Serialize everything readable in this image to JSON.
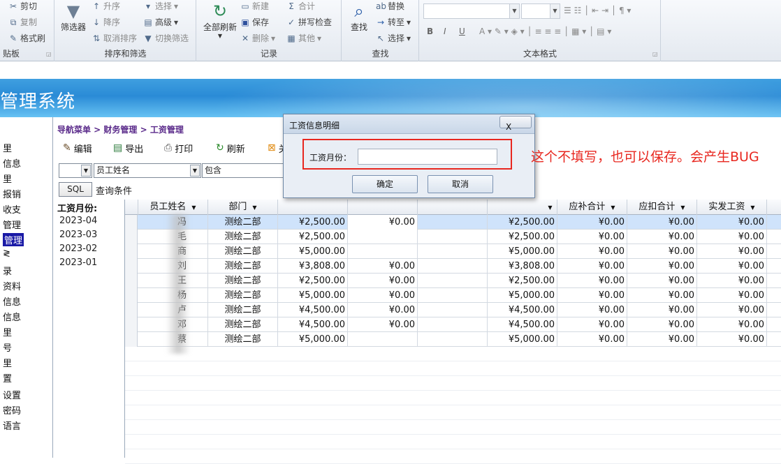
{
  "ribbon": {
    "clipboard": {
      "cut": "剪切",
      "copy": "复制",
      "format_painter": "格式刷",
      "group_label": "贴板"
    },
    "sort_filter": {
      "filter_label": "筛选器",
      "ascending": "升序",
      "descending": "降序",
      "remove_sort": "取消排序",
      "selection": "选择",
      "advanced": "高级",
      "toggle_filter": "切换筛选",
      "group_label": "排序和筛选"
    },
    "records": {
      "refresh_all": "全部刷新",
      "new": "新建",
      "save": "保存",
      "delete": "删除",
      "totals": "合计",
      "spelling": "拼写检查",
      "more": "其他",
      "group_label": "记录"
    },
    "find": {
      "find": "查找",
      "replace": "替换",
      "goto": "转至",
      "select": "选择",
      "group_label": "查找"
    },
    "text_format": {
      "bold": "B",
      "italic": "I",
      "underline": "U",
      "font_color": "A",
      "group_label": "文本格式"
    }
  },
  "app": {
    "title": "管理系统"
  },
  "nav": {
    "items": [
      "里",
      "信息",
      "里",
      "报销",
      "收支",
      "管理",
      "管理",
      "≷",
      "录",
      "资料",
      "信息",
      "信息",
      "里",
      "号",
      "里",
      "置",
      "设置",
      "密码",
      "语言"
    ],
    "selected_index": 6
  },
  "breadcrumb": "导航菜单 > 财务管理 > 工资管理",
  "toolbar": {
    "edit": "编辑",
    "export": "导出",
    "print": "打印",
    "refresh": "刷新",
    "close_partial": "关"
  },
  "filter": {
    "field_name": "员工姓名",
    "operator": "包含",
    "sql_button": "SQL",
    "query_label": "查询条件"
  },
  "months": {
    "header": "工资月份:",
    "items": [
      "2023-04",
      "2023-03",
      "2023-02",
      "2023-01"
    ]
  },
  "grid": {
    "columns": [
      "员工姓名",
      "部门",
      "",
      "",
      "",
      "",
      "应补合计",
      "应扣合计",
      "实发工资"
    ],
    "rows": [
      {
        "name": "冯",
        "dept": "测绘二部",
        "base": "¥2,500.00",
        "c2": "¥0.00",
        "c3": "",
        "total": "¥2,500.00",
        "add": "¥0.00",
        "deduct": "¥0.00",
        "net": "¥0.00"
      },
      {
        "name": "毛",
        "dept": "测绘二部",
        "base": "¥2,500.00",
        "c2": "",
        "c3": "",
        "total": "¥2,500.00",
        "add": "¥0.00",
        "deduct": "¥0.00",
        "net": "¥0.00"
      },
      {
        "name": "商",
        "dept": "测绘二部",
        "base": "¥5,000.00",
        "c2": "",
        "c3": "",
        "total": "¥5,000.00",
        "add": "¥0.00",
        "deduct": "¥0.00",
        "net": "¥0.00"
      },
      {
        "name": "刘",
        "dept": "测绘二部",
        "base": "¥3,808.00",
        "c2": "¥0.00",
        "c3": "",
        "total": "¥3,808.00",
        "add": "¥0.00",
        "deduct": "¥0.00",
        "net": "¥0.00"
      },
      {
        "name": "王",
        "dept": "测绘二部",
        "base": "¥2,500.00",
        "c2": "¥0.00",
        "c3": "",
        "total": "¥2,500.00",
        "add": "¥0.00",
        "deduct": "¥0.00",
        "net": "¥0.00"
      },
      {
        "name": "杨",
        "dept": "测绘二部",
        "base": "¥5,000.00",
        "c2": "¥0.00",
        "c3": "",
        "total": "¥5,000.00",
        "add": "¥0.00",
        "deduct": "¥0.00",
        "net": "¥0.00"
      },
      {
        "name": "卢",
        "dept": "测绘二部",
        "base": "¥4,500.00",
        "c2": "¥0.00",
        "c3": "",
        "total": "¥4,500.00",
        "add": "¥0.00",
        "deduct": "¥0.00",
        "net": "¥0.00"
      },
      {
        "name": "邓",
        "dept": "测绘二部",
        "base": "¥4,500.00",
        "c2": "¥0.00",
        "c3": "",
        "total": "¥4,500.00",
        "add": "¥0.00",
        "deduct": "¥0.00",
        "net": "¥0.00"
      },
      {
        "name": "蔡",
        "dept": "测绘二部",
        "base": "¥5,000.00",
        "c2": "",
        "c3": "",
        "total": "¥5,000.00",
        "add": "¥0.00",
        "deduct": "¥0.00",
        "net": "¥0.00"
      }
    ]
  },
  "dialog": {
    "title": "工资信息明细",
    "close": "X",
    "field_label": "工资月份：",
    "field_value": "",
    "ok": "确定",
    "cancel": "取消"
  },
  "annotation": "这个不填写，也可以保存。会产生BUG",
  "colors": {
    "accent": "#e8271f",
    "selected_row": "#cfe3fb",
    "banner": "#2a8bd6",
    "nav_selected": "#1a1aa6"
  }
}
